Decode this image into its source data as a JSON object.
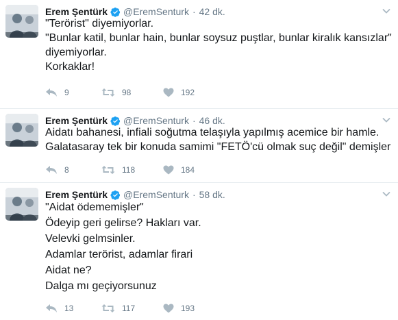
{
  "tweets": [
    {
      "name": "Erem Şentürk",
      "handle": "@EremSenturk",
      "separator": "·",
      "time": "42 dk.",
      "lines": [
        "\"Terörist\" diyemiyorlar.",
        "\"Bunlar katil, bunlar hain, bunlar soysuz puştlar, bunlar kiralık kansızlar\"",
        "diyemiyorlar.",
        "Korkaklar!"
      ],
      "replies": "9",
      "retweets": "98",
      "likes": "192"
    },
    {
      "name": "Erem Şentürk",
      "handle": "@EremSenturk",
      "separator": "·",
      "time": "46 dk.",
      "lines": [
        "Aidatı bahanesi, infiali soğutma telaşıyla yapılmış acemice bir hamle.",
        "Galatasaray tek bir konuda samimi \"FETÖ'cü olmak suç değil\" demişler"
      ],
      "replies": "8",
      "retweets": "118",
      "likes": "184"
    },
    {
      "name": "Erem Şentürk",
      "handle": "@EremSenturk",
      "separator": "·",
      "time": "58 dk.",
      "lines": [
        "\"Aidat ödememişler\"",
        "Ödeyip geri gelirse? Hakları var.",
        "Velevki gelmsinler.",
        "Adamlar terörist, adamlar firari",
        "Aidat ne?",
        "Dalga mı geçiyorsunuz"
      ],
      "replies": "13",
      "retweets": "117",
      "likes": "193"
    }
  ],
  "colors": {
    "text": "#14171a",
    "muted": "#657786",
    "verified": "#1da1f2",
    "divider": "#e6ecf0"
  },
  "icons": {
    "verified": "verified-badge-icon",
    "more": "chevron-down-icon",
    "reply": "reply-icon",
    "retweet": "retweet-icon",
    "like": "heart-icon"
  }
}
